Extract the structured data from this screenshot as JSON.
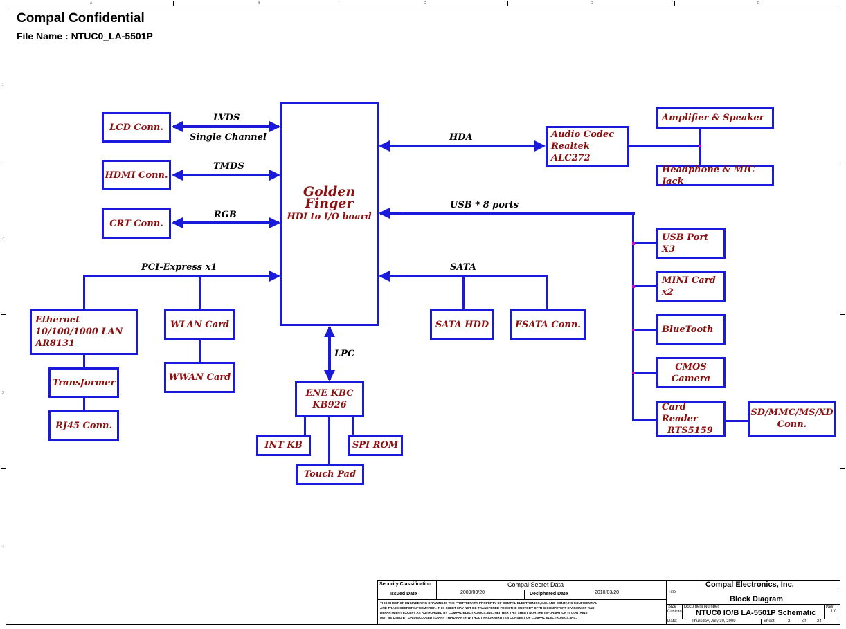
{
  "header": {
    "title": "Compal Confidential",
    "file_name": "File Name : NTUC0_LA-5501P"
  },
  "blocks": {
    "lcd": "LCD Conn.",
    "hdmi": "HDMI Conn.",
    "crt": "CRT Conn.",
    "golden_title": "Golden Finger",
    "golden_sub": "HDI to I/O board",
    "audio_l1": "Audio Codec",
    "audio_l2": "Realtek ALC272",
    "amp": "Amplifier & Speaker",
    "headphone": "Headphone & MIC Jack",
    "usb3": "USB Port X3",
    "minicard": "MINI Card x2",
    "bluetooth": "BlueTooth",
    "cmos": "CMOS Camera",
    "cardreader_l1": "Card Reader",
    "cardreader_l2": "RTS5159",
    "sd_l1": "SD/MMC/MS/XD",
    "sd_l2": "Conn.",
    "eth_l1": "Ethernet",
    "eth_l2": "10/100/1000 LAN",
    "eth_l3": "AR8131",
    "wlan": "WLAN Card",
    "wwan": "WWAN Card",
    "transformer": "Transformer",
    "rj45": "RJ45 Conn.",
    "sata_hdd": "SATA HDD",
    "esata": "ESATA Conn.",
    "ene_l1": "ENE KBC",
    "ene_l2": "KB926",
    "intkb": "INT KB",
    "spirom": "SPI ROM",
    "touchpad": "Touch Pad"
  },
  "labels": {
    "lvds": "LVDS",
    "single_channel": "Single Channel",
    "tmds": "TMDS",
    "rgb": "RGB",
    "pcie": "PCI-Express x1",
    "hda": "HDA",
    "usb": "USB * 8 ports",
    "sata": "SATA",
    "lpc": "LPC"
  },
  "frame": {
    "col_letters": [
      "A",
      "B",
      "C",
      "D",
      "E"
    ],
    "row_numbers": [
      "1",
      "2",
      "3",
      "4"
    ]
  },
  "title_block": {
    "security_classification": "Security Classification",
    "compal_secret": "Compal Secret Data",
    "issued_date_label": "Issued Date",
    "issued_date": "2009/03/20",
    "deciphered_date_label": "Deciphered Date",
    "deciphered_date": "2010/03/20",
    "company": "Compal Electronics, Inc.",
    "title_label": "Title",
    "title": "Block Diagram",
    "size_label": "Size",
    "size": "Custom",
    "doc_label": "Document Number",
    "doc": "NTUC0 IO/B LA-5501P Schematic",
    "rev_label": "Rev",
    "rev": "1.0",
    "date_label": "Date:",
    "date": "Thursday, July 30, 2009",
    "sheet_label": "Sheet",
    "sheet": "2",
    "of_label": "of",
    "total": "24",
    "notice_1": "THIS SHEET OF ENGINEERING DRAWING IS THE PROPRIETARY PROPERTY OF COMPAL ELECTRONICS, INC. AND CONTAINS CONFIDENTIAL",
    "notice_2": "AND TRADE SECRET INFORMATION. THIS SHEET MAY NOT BE TRANSFERED FROM THE CUSTODY OF THE COMPETENT DIVISION OF R&D",
    "notice_3": "DEPARTMENT EXCEPT AS AUTHORIZED BY COMPAL ELECTRONICS, INC. NEITHER THIS SHEET NOR THE INFORMATION IT CONTAINS",
    "notice_4": "MAY BE USED BY OR DISCLOSED TO ANY THIRD PARTY WITHOUT PRIOR WRITTEN CONSENT OF COMPAL ELECTRONICS, INC."
  },
  "colors": {
    "line": "#1a1adc",
    "block_text": "#8b1010",
    "junction": "#e000d0"
  }
}
